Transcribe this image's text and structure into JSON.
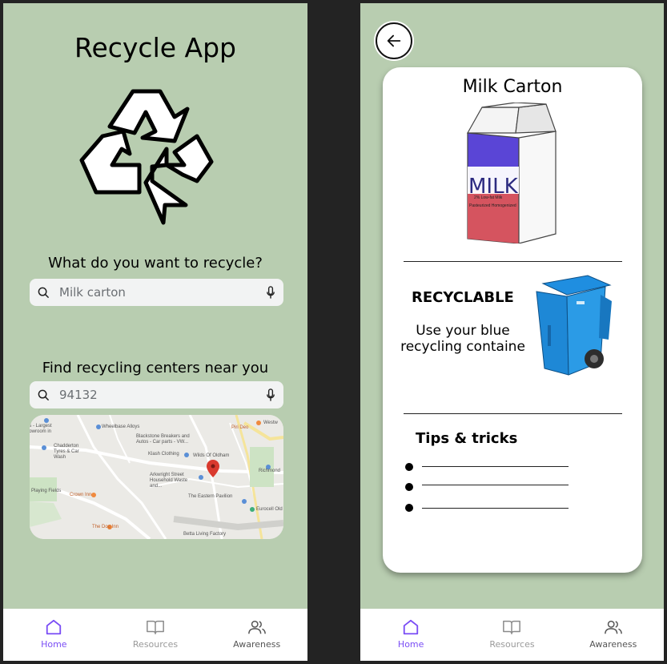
{
  "home": {
    "app_title": "Recycle App",
    "question": "What do you want to recycle?",
    "search": {
      "value": "Milk carton"
    },
    "find_label": "Find recycling centers near you",
    "location": {
      "value": "94132"
    },
    "map_labels": [
      "Wheelbase Alloys",
      "Blackstone Breakers and Autos - Car parts - VW...",
      "Chadderton Tyres & Car Wash",
      "Klash Clothing",
      "Wilds Of Oldham",
      "Arkwright Street Household Waste and...",
      "Playing Fields",
      "Crown Inn",
      "The Eastern Pavilion",
      "Eurocell Old",
      "The Dog Inn",
      "Betta Living Factory",
      "Richmond",
      "Westw",
      "Piri Deo",
      "ns - Largest howroom in"
    ]
  },
  "nav": {
    "home": "Home",
    "resources": "Resources",
    "awareness": "Awareness"
  },
  "detail": {
    "item_title": "Milk Carton",
    "carton_text": "MILK",
    "carton_subtext": "2% Low-fat Milk",
    "carton_subtext2": "Pasteurized Homogenized",
    "status": "RECYCLABLE",
    "instruction": "Use your blue recycling containe",
    "tips_title": "Tips & tricks",
    "tips": [
      "",
      "",
      ""
    ]
  },
  "colors": {
    "screen_bg": "#b8cdb0",
    "accent": "#7a4df5",
    "bin_blue": "#1e88d6",
    "carton_purple": "#5a45d6",
    "carton_red": "#d5545f"
  }
}
